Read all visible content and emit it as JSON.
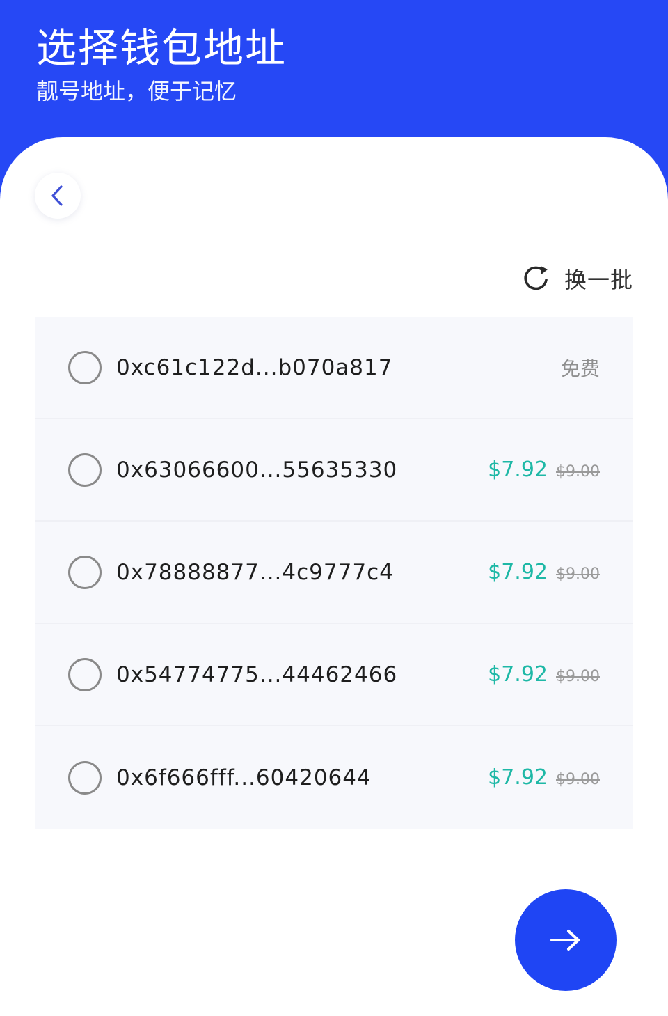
{
  "header": {
    "title": "选择钱包地址",
    "subtitle": "靓号地址，便于记忆"
  },
  "icons": {
    "back": "chevron-left-icon",
    "refresh": "refresh-icon",
    "next": "arrow-right-icon"
  },
  "refresh": {
    "label": "换一批"
  },
  "colors": {
    "brand": "#2648f5",
    "discount_price": "#1eb8a6",
    "muted": "#9a9a9a"
  },
  "addresses": [
    {
      "address": "0xc61c122d...b070a817",
      "free_label": "免费"
    },
    {
      "address": "0x63066600...55635330",
      "price": "$7.92",
      "original_price": "$9.00"
    },
    {
      "address": "0x78888877...4c9777c4",
      "price": "$7.92",
      "original_price": "$9.00"
    },
    {
      "address": "0x54774775...44462466",
      "price": "$7.92",
      "original_price": "$9.00"
    },
    {
      "address": "0x6f666fff...60420644",
      "price": "$7.92",
      "original_price": "$9.00"
    }
  ]
}
